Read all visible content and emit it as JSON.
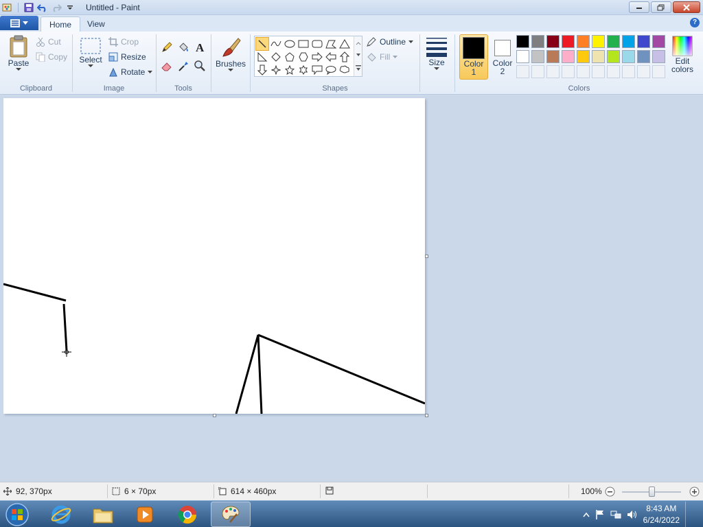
{
  "window": {
    "title": "Untitled - Paint"
  },
  "tabs": [
    {
      "label": "Home",
      "active": true
    },
    {
      "label": "View",
      "active": false
    }
  ],
  "clipboard": {
    "group_label": "Clipboard",
    "paste": "Paste",
    "cut": "Cut",
    "copy": "Copy"
  },
  "image": {
    "group_label": "Image",
    "select": "Select",
    "crop": "Crop",
    "resize": "Resize",
    "rotate": "Rotate"
  },
  "tools": {
    "group_label": "Tools",
    "items": [
      "pencil-icon",
      "fill-bucket-icon",
      "text-icon",
      "eraser-icon",
      "color-picker-icon",
      "magnifier-icon"
    ]
  },
  "brushes": {
    "label": "Brushes"
  },
  "shapes": {
    "group_label": "Shapes",
    "outline": "Outline",
    "fill": "Fill",
    "selected": "line"
  },
  "size": {
    "label": "Size"
  },
  "colors": {
    "group_label": "Colors",
    "color1_label": "Color",
    "color1_num": "1",
    "color2_label": "Color",
    "color2_num": "2",
    "color1": "#000000",
    "color2": "#ffffff",
    "edit_label": "Edit",
    "edit_label2": "colors",
    "row1": [
      "#000000",
      "#7f7f7f",
      "#880015",
      "#ed1c24",
      "#ff7f27",
      "#fff200",
      "#22b14c",
      "#00a2e8",
      "#3f48cc",
      "#a349a4"
    ],
    "row2": [
      "#ffffff",
      "#c3c3c3",
      "#b97a57",
      "#ffaec9",
      "#ffc90e",
      "#efe4b0",
      "#b5e61d",
      "#99d9ea",
      "#7092be",
      "#c8bfe7"
    ]
  },
  "status": {
    "cursor_pos": "92, 370px",
    "selection_size": "6 × 70px",
    "canvas_size": "614 × 460px",
    "zoom": "100%"
  },
  "taskbar": {
    "time": "8:43 AM",
    "date": "6/24/2022"
  }
}
